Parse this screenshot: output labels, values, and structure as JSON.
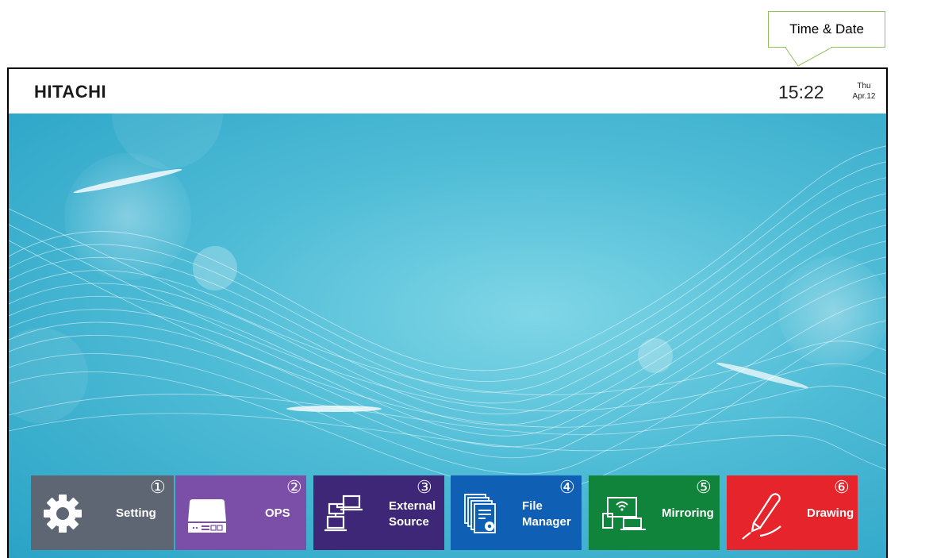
{
  "callout": {
    "text": "Time & Date"
  },
  "topbar": {
    "logo": "HITACHI",
    "time": "15:22",
    "day": "Thu",
    "date": "Apr.12"
  },
  "tiles": [
    {
      "number": "①",
      "label": "Setting",
      "icon": "gear-icon",
      "color": "#5f6673"
    },
    {
      "number": "②",
      "label": "OPS",
      "icon": "ops-device-icon",
      "color": "#7b4fa8"
    },
    {
      "number": "③",
      "label_line1": "External",
      "label_line2": "Source",
      "icon": "external-source-icon",
      "color": "#3e2777"
    },
    {
      "number": "④",
      "label_line1": "File",
      "label_line2": "Manager",
      "icon": "file-manager-icon",
      "color": "#0f5fb5"
    },
    {
      "number": "⑤",
      "label": "Mirroring",
      "icon": "screen-mirroring-icon",
      "color": "#10843a"
    },
    {
      "number": "⑥",
      "label": "Drawing",
      "icon": "pen-icon",
      "color": "#e5242b"
    }
  ]
}
